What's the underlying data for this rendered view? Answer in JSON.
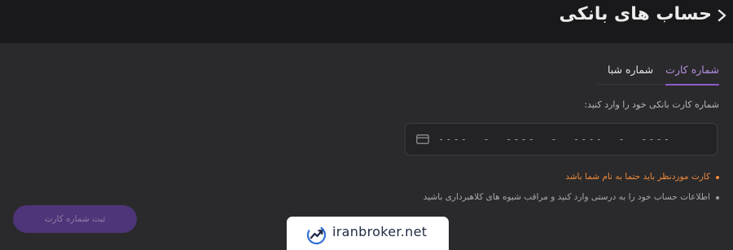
{
  "header": {
    "title": "حساب های بانکی",
    "back_icon": "chevron-right-icon"
  },
  "tabs": [
    {
      "label": "شماره کارت",
      "active": true
    },
    {
      "label": "شماره شبا",
      "active": false
    }
  ],
  "form": {
    "instruction": "شماره کارت بانکی خود را وارد کنید:",
    "card_input_value": "----  -  ----  -  ----  -  ----",
    "card_icon": "credit-card-icon"
  },
  "notes": [
    "کارت موردنظر باید حتما به نام شما باشد",
    "اطلاعات حساب خود را به درستی وارد کنید و مراقب شیوه های کلاهبرداری باشید"
  ],
  "submit_label": "ثبت شماره کارت",
  "watermark": {
    "text": "iranbroker.net"
  },
  "colors": {
    "accent": "#8b5cc9",
    "warning": "#f08a3c",
    "background": "#2a2a2c",
    "header": "#19191b"
  }
}
